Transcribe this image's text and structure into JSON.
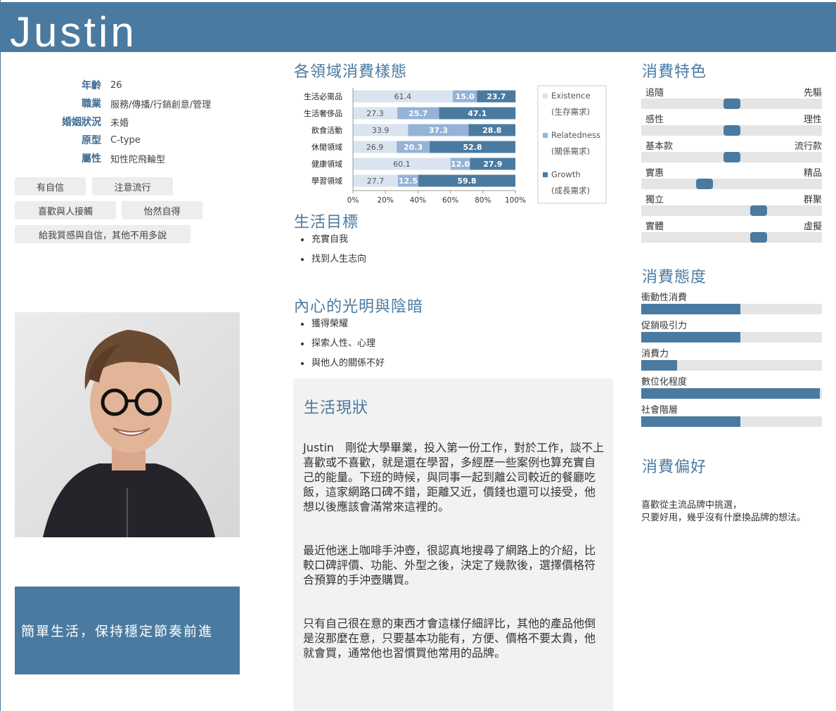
{
  "persona": {
    "name": "Justin",
    "profile": [
      {
        "label": "年齡",
        "value": "26"
      },
      {
        "label": "職業",
        "value": "服務/傳播/行銷創意/管理"
      },
      {
        "label": "婚姻狀況",
        "value": "未婚"
      },
      {
        "label": "原型",
        "value": "C-type"
      },
      {
        "label": "屬性",
        "value": "知性陀飛輪型"
      }
    ],
    "tags": [
      "有自信",
      "注意流行",
      "喜歡與人接觸",
      "怡然自得",
      "給我質感與自信，其他不用多說"
    ],
    "quote": "簡單生活，保持穩定節奏前進"
  },
  "sections": {
    "consumption_patterns": "各領域消費樣態",
    "life_goals": "生活目標",
    "inner_light_dark": "內心的光明與陰暗",
    "life_status": "生活現狀",
    "consumption_traits": "消費特色",
    "consumption_attitude": "消費態度",
    "consumption_preference": "消費偏好"
  },
  "life_goals": [
    "充實自我",
    "找到人生志向"
  ],
  "inner_light_dark": [
    "獲得榮耀",
    "探索人性、心理",
    "與他人的關係不好"
  ],
  "life_status": [
    "Justin　剛從大學畢業，投入第一份工作，對於工作，談不上喜歡或不喜歡，就是還在學習，多經歷一些案例也算充實自己的能量。下班的時候，與同事一起到離公司較近的餐廳吃飯，這家網路口碑不錯，距離又近，價錢也還可以接受，他想以後應該會滿常來這裡的。",
    "最近他迷上咖啡手沖壺，很認真地搜尋了網路上的介紹，比較口碑評價、功能、外型之後，決定了幾款後，選擇價格符合預算的手沖壺購買。",
    "只有自己很在意的東西才會這樣仔細評比，其他的產品他倒是沒那麼在意，只要基本功能有，方便、價格不要太貴，他就會買，通常他也習慣買他常用的品牌。"
  ],
  "traits": [
    {
      "left": "追隨",
      "right": "先驅",
      "value": 0.5
    },
    {
      "left": "感性",
      "right": "理性",
      "value": 0.5
    },
    {
      "left": "基本款",
      "right": "流行款",
      "value": 0.5
    },
    {
      "left": "實惠",
      "right": "精品",
      "value": 0.35
    },
    {
      "left": "獨立",
      "right": "群聚",
      "value": 0.65
    },
    {
      "left": "實體",
      "right": "虛擬",
      "value": 0.65
    }
  ],
  "attitudes": [
    {
      "label": "衝動性消費",
      "value": 0.55
    },
    {
      "label": "促銷吸引力",
      "value": 0.55
    },
    {
      "label": "消費力",
      "value": 0.2
    },
    {
      "label": "數位化程度",
      "value": 0.99
    },
    {
      "label": "社會階層",
      "value": 0.55
    }
  ],
  "preference": [
    "喜歡從主流品牌中挑選，",
    "只要好用，幾乎沒有什麼換品牌的想法。"
  ],
  "colors": {
    "accent": "#4a7aa0",
    "existence": "#dae3f0",
    "relatedness": "#95b3d7",
    "growth": "#4a7aa0"
  },
  "chart_data": {
    "type": "bar",
    "stacked": true,
    "horizontal": true,
    "percent": true,
    "categories": [
      "生活必需品",
      "生活奢侈品",
      "飲食活動",
      "休閒領域",
      "健康領域",
      "學習領域"
    ],
    "series": [
      {
        "name": "Existence",
        "sub": "(生存需求)",
        "values": [
          61.4,
          27.3,
          33.9,
          26.9,
          60.1,
          27.7
        ]
      },
      {
        "name": "Relatedness",
        "sub": "(關係需求)",
        "values": [
          15.0,
          25.7,
          37.3,
          20.3,
          12.0,
          12.5
        ]
      },
      {
        "name": "Growth",
        "sub": "(成長需求)",
        "values": [
          23.7,
          47.1,
          28.8,
          52.8,
          27.9,
          59.8
        ]
      }
    ],
    "xticks": [
      "0%",
      "20%",
      "40%",
      "60%",
      "80%",
      "100%"
    ],
    "xlim": [
      0,
      100
    ],
    "legend": "right"
  }
}
